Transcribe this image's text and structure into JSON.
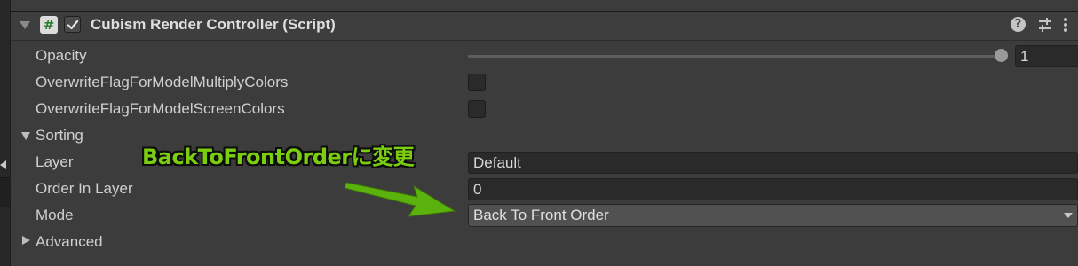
{
  "component": {
    "title": "Cubism Render Controller (Script)",
    "script_glyph": "#",
    "enabled": true,
    "help_glyph": "?"
  },
  "properties": {
    "opacity": {
      "label": "Opacity",
      "value": "1",
      "slider_fraction": 1.0
    },
    "overwrite_multiply": {
      "label": "OverwriteFlagForModelMultiplyColors",
      "checked": false
    },
    "overwrite_screen": {
      "label": "OverwriteFlagForModelScreenColors",
      "checked": false
    },
    "sorting": {
      "label": "Sorting",
      "expanded": true,
      "layer": {
        "label": "Layer",
        "value": "Default"
      },
      "order_in_layer": {
        "label": "Order In Layer",
        "value": "0"
      },
      "mode": {
        "label": "Mode",
        "value": "Back To Front Order"
      }
    },
    "advanced": {
      "label": "Advanced",
      "expanded": false
    }
  },
  "annotation": {
    "text": "BackToFrontOrderに変更",
    "color": "#7acd0f"
  },
  "colors": {
    "panel_bg": "#383838",
    "field_bg": "#2a2a2a",
    "dropdown_bg": "#515151",
    "text": "#d2d2d2"
  }
}
